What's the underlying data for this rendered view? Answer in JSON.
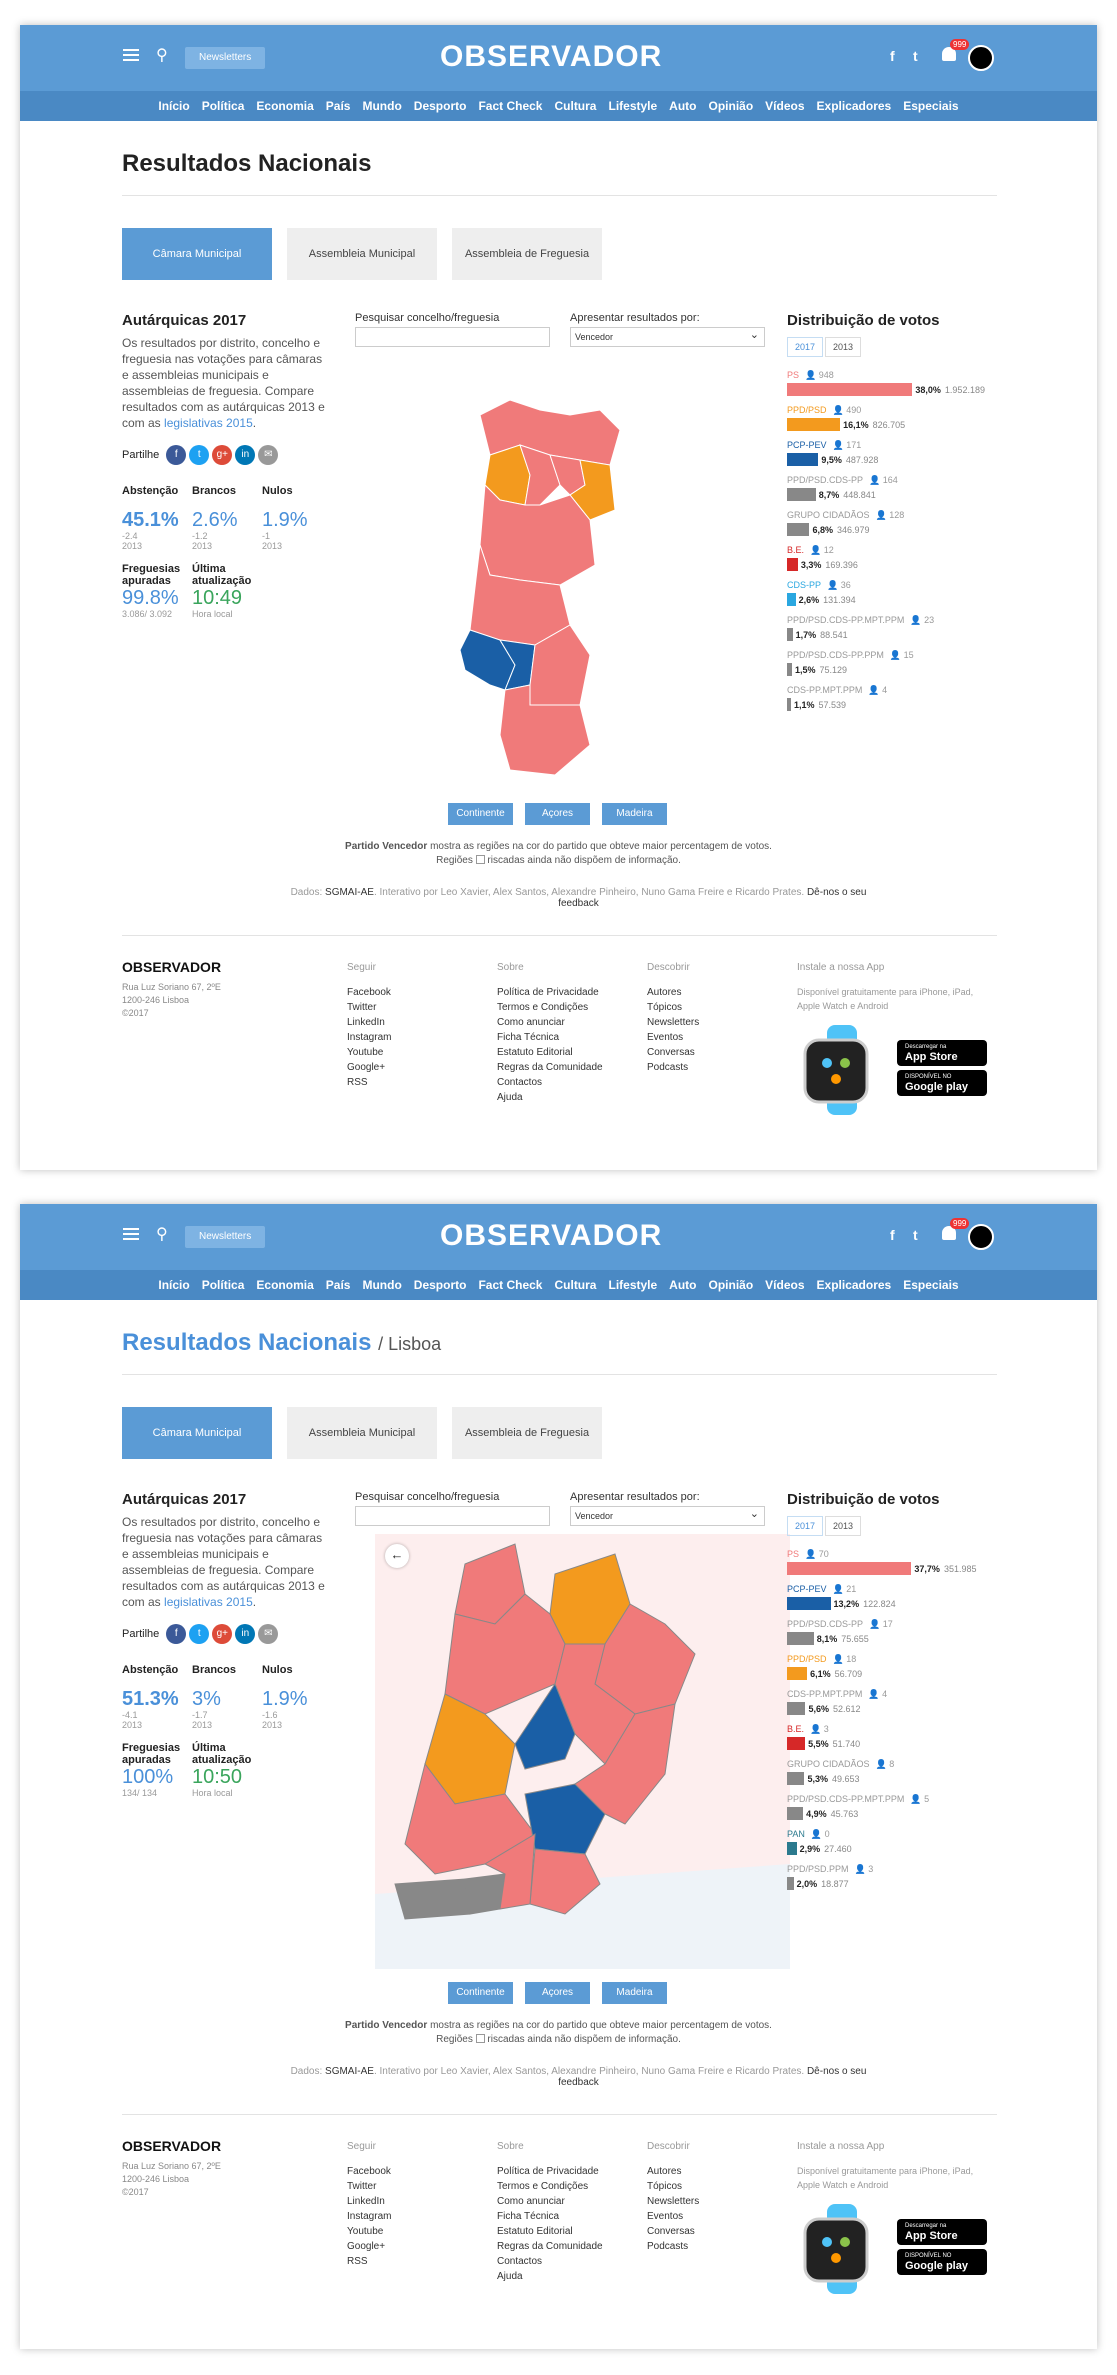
{
  "header": {
    "newsletters": "Newsletters",
    "logo": "OBSERVADOR",
    "notif_count": "999",
    "nav": [
      "Início",
      "Política",
      "Economia",
      "País",
      "Mundo",
      "Desporto",
      "Fact Check",
      "Cultura",
      "Lifestyle",
      "Auto",
      "Opinião",
      "Vídeos",
      "Explicadores",
      "Especiais"
    ]
  },
  "tabs": [
    "Câmara Municipal",
    "Assembleia Municipal",
    "Assembleia de Freguesia"
  ],
  "left": {
    "title": "Autárquicas 2017",
    "desc": "Os resultados por distrito, concelho e freguesia nas votações para câmaras e assembleias municipais e assembleias de freguesia. Compare resultados com as autárquicas 2013 e com as",
    "desc_link": "legislativas 2015",
    "share": "Partilhe",
    "labels": {
      "abst": "Abstenção",
      "brancos": "Brancos",
      "nulos": "Nulos",
      "freg": "Freguesias apuradas",
      "upd": "Última atualização"
    }
  },
  "middle": {
    "search_label": "Pesquisar concelho/freguesia",
    "results_label": "Apresentar resultados por:",
    "results_value": "Vencedor",
    "regions": [
      "Continente",
      "Açores",
      "Madeira"
    ],
    "legend_bold": "Partido Vencedor",
    "legend_1": "mostra as regiões na cor do partido que obteve maior percentagem de votos.",
    "legend_2a": "Regiões",
    "legend_2b": "riscadas ainda não dispõem de informação.",
    "credits_pre": "Dados:",
    "credits_src": "SGMAI-AE",
    "credits_mid": ". Interativo por Leo Xavier, Alex Santos, Alexandre Pinheiro, Nuno Gama Freire e Ricardo Prates.",
    "credits_fb": "Dê-nos o seu feedback"
  },
  "right": {
    "title": "Distribuição de votos",
    "years": [
      "2017",
      "2013"
    ]
  },
  "colors": {
    "ps": "#f07a7a",
    "psd": "#f39a1e",
    "pcp": "#1a5fa6",
    "grey": "#888888",
    "be": "#d62828",
    "cds": "#2aa7e0",
    "pan": "#2b7a8e"
  },
  "page1": {
    "title": "Resultados Nacionais",
    "subtitle": "",
    "stats": {
      "abst": "45.1%",
      "abst_d": "-2.4",
      "abst_y": "2013",
      "brancos": "2.6%",
      "brancos_d": "-1.2",
      "brancos_y": "2013",
      "nulos": "1.9%",
      "nulos_d": "-1",
      "nulos_y": "2013",
      "freg": "99.8%",
      "freg_n": "3.086/ 3.092",
      "upd": "10:49",
      "upd_l": "Hora local"
    },
    "parties": [
      {
        "name": "PS",
        "seats": "948",
        "pct": "38,0%",
        "votes": "1.952.189",
        "color": "ps",
        "frac": 0.38
      },
      {
        "name": "PPD/PSD",
        "seats": "490",
        "pct": "16,1%",
        "votes": "826.705",
        "color": "psd",
        "frac": 0.161
      },
      {
        "name": "PCP-PEV",
        "seats": "171",
        "pct": "9,5%",
        "votes": "487.928",
        "color": "pcp",
        "frac": 0.095
      },
      {
        "name": "PPD/PSD.CDS-PP",
        "seats": "164",
        "pct": "8,7%",
        "votes": "448.841",
        "color": "grey",
        "frac": 0.087
      },
      {
        "name": "GRUPO CIDADÃOS",
        "seats": "128",
        "pct": "6,8%",
        "votes": "346.979",
        "color": "grey",
        "frac": 0.068
      },
      {
        "name": "B.E.",
        "seats": "12",
        "pct": "3,3%",
        "votes": "169.396",
        "color": "be",
        "frac": 0.033
      },
      {
        "name": "CDS-PP",
        "seats": "36",
        "pct": "2,6%",
        "votes": "131.394",
        "color": "cds",
        "frac": 0.026
      },
      {
        "name": "PPD/PSD.CDS-PP.MPT.PPM",
        "seats": "23",
        "pct": "1,7%",
        "votes": "88.541",
        "color": "grey",
        "frac": 0.017
      },
      {
        "name": "PPD/PSD.CDS-PP.PPM",
        "seats": "15",
        "pct": "1,5%",
        "votes": "75.129",
        "color": "grey",
        "frac": 0.015
      },
      {
        "name": "CDS-PP.MPT.PPM",
        "seats": "4",
        "pct": "1,1%",
        "votes": "57.539",
        "color": "grey",
        "frac": 0.011
      }
    ]
  },
  "page2": {
    "title": "Resultados Nacionais",
    "subtitle": "/ Lisboa",
    "stats": {
      "abst": "51.3%",
      "abst_d": "-4.1",
      "abst_y": "2013",
      "brancos": "3%",
      "brancos_d": "-1.7",
      "brancos_y": "2013",
      "nulos": "1.9%",
      "nulos_d": "-1.6",
      "nulos_y": "2013",
      "freg": "100%",
      "freg_n": "134/ 134",
      "upd": "10:50",
      "upd_l": "Hora local"
    },
    "parties": [
      {
        "name": "PS",
        "seats": "70",
        "pct": "37,7%",
        "votes": "351.985",
        "color": "ps",
        "frac": 0.377
      },
      {
        "name": "PCP-PEV",
        "seats": "21",
        "pct": "13,2%",
        "votes": "122.824",
        "color": "pcp",
        "frac": 0.132
      },
      {
        "name": "PPD/PSD.CDS-PP",
        "seats": "17",
        "pct": "8,1%",
        "votes": "75.655",
        "color": "grey",
        "frac": 0.081
      },
      {
        "name": "PPD/PSD",
        "seats": "18",
        "pct": "6,1%",
        "votes": "56.709",
        "color": "psd",
        "frac": 0.061
      },
      {
        "name": "CDS-PP.MPT.PPM",
        "seats": "4",
        "pct": "5,6%",
        "votes": "52.612",
        "color": "grey",
        "frac": 0.056
      },
      {
        "name": "B.E.",
        "seats": "3",
        "pct": "5,5%",
        "votes": "51.740",
        "color": "be",
        "frac": 0.055
      },
      {
        "name": "GRUPO CIDADÃOS",
        "seats": "8",
        "pct": "5,3%",
        "votes": "49.653",
        "color": "grey",
        "frac": 0.053
      },
      {
        "name": "PPD/PSD.CDS-PP.MPT.PPM",
        "seats": "5",
        "pct": "4,9%",
        "votes": "45.763",
        "color": "grey",
        "frac": 0.049
      },
      {
        "name": "PAN",
        "seats": "0",
        "pct": "2,9%",
        "votes": "27.460",
        "color": "pan",
        "frac": 0.029
      },
      {
        "name": "PPD/PSD.PPM",
        "seats": "3",
        "pct": "2,0%",
        "votes": "18.877",
        "color": "grey",
        "frac": 0.02
      }
    ]
  },
  "footer": {
    "logo": "OBSERVADOR",
    "address": [
      "Rua Luz Soriano 67, 2ºE",
      "1200-246 Lisboa",
      "©2017"
    ],
    "seguir_h": "Seguir",
    "seguir": [
      "Facebook",
      "Twitter",
      "LinkedIn",
      "Instagram",
      "Youtube",
      "Google+",
      "RSS"
    ],
    "sobre_h": "Sobre",
    "sobre": [
      "Política de Privacidade",
      "Termos e Condições",
      "Como anunciar",
      "Ficha Técnica",
      "Estatuto Editorial",
      "Regras da Comunidade",
      "Contactos",
      "Ajuda"
    ],
    "desc_h": "Descobrir",
    "desc": [
      "Autores",
      "Tópicos",
      "Newsletters",
      "Eventos",
      "Conversas",
      "Podcasts"
    ],
    "app_h": "Instale a nossa App",
    "app_t": "Disponível gratuitamente para iPhone, iPad, Apple Watch e Android",
    "appstore_s": "Descarregar na",
    "appstore": "App Store",
    "gplay_s": "DISPONÍVEL NO",
    "gplay": "Google play"
  }
}
